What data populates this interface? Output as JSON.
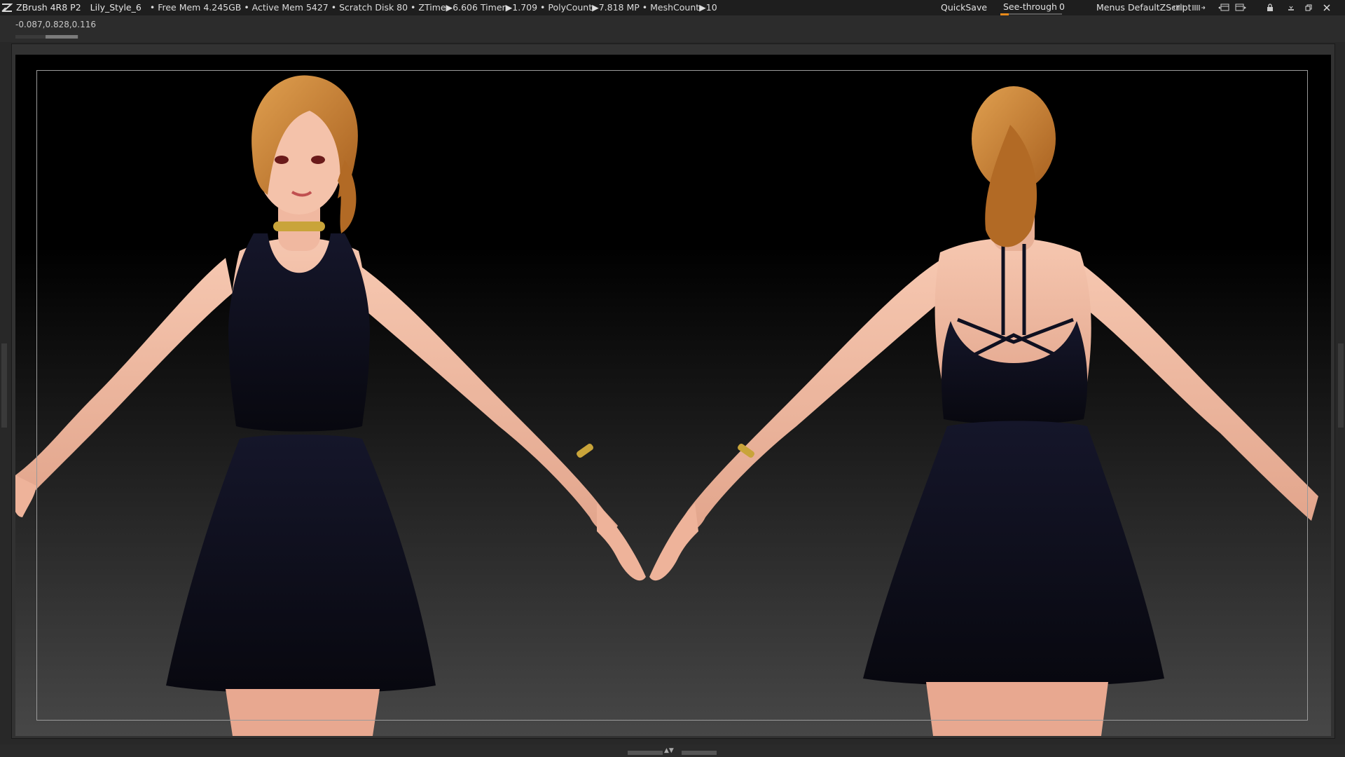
{
  "titlebar": {
    "app_name": "ZBrush 4R8 P2",
    "document_name": "Lily_Style_6",
    "stats": "• Free Mem 4.245GB • Active Mem 5427 • Scratch Disk 80 •  ZTime▶6.606 Timer▶1.709 • PolyCount▶7.818 MP  • MeshCount▶10",
    "quicksave_label": "QuickSave",
    "seethrough_label": "See-through",
    "seethrough_value": "0",
    "menus_label": "Menus",
    "script_label": "DefaultZScript"
  },
  "subbar": {
    "coordinates": "-0.087,0.828,0.116"
  },
  "icons": {
    "logo": "zbrush-logo-icon",
    "seethrough_level": 0,
    "colors": {
      "accent": "#e88a1a",
      "titlebar": "#1e1e1e",
      "panel": "#2c2c2c",
      "skin": "#f0b8a0",
      "dress": "#0f1020",
      "hair": "#c77a2e",
      "gold": "#c9a43a"
    }
  }
}
